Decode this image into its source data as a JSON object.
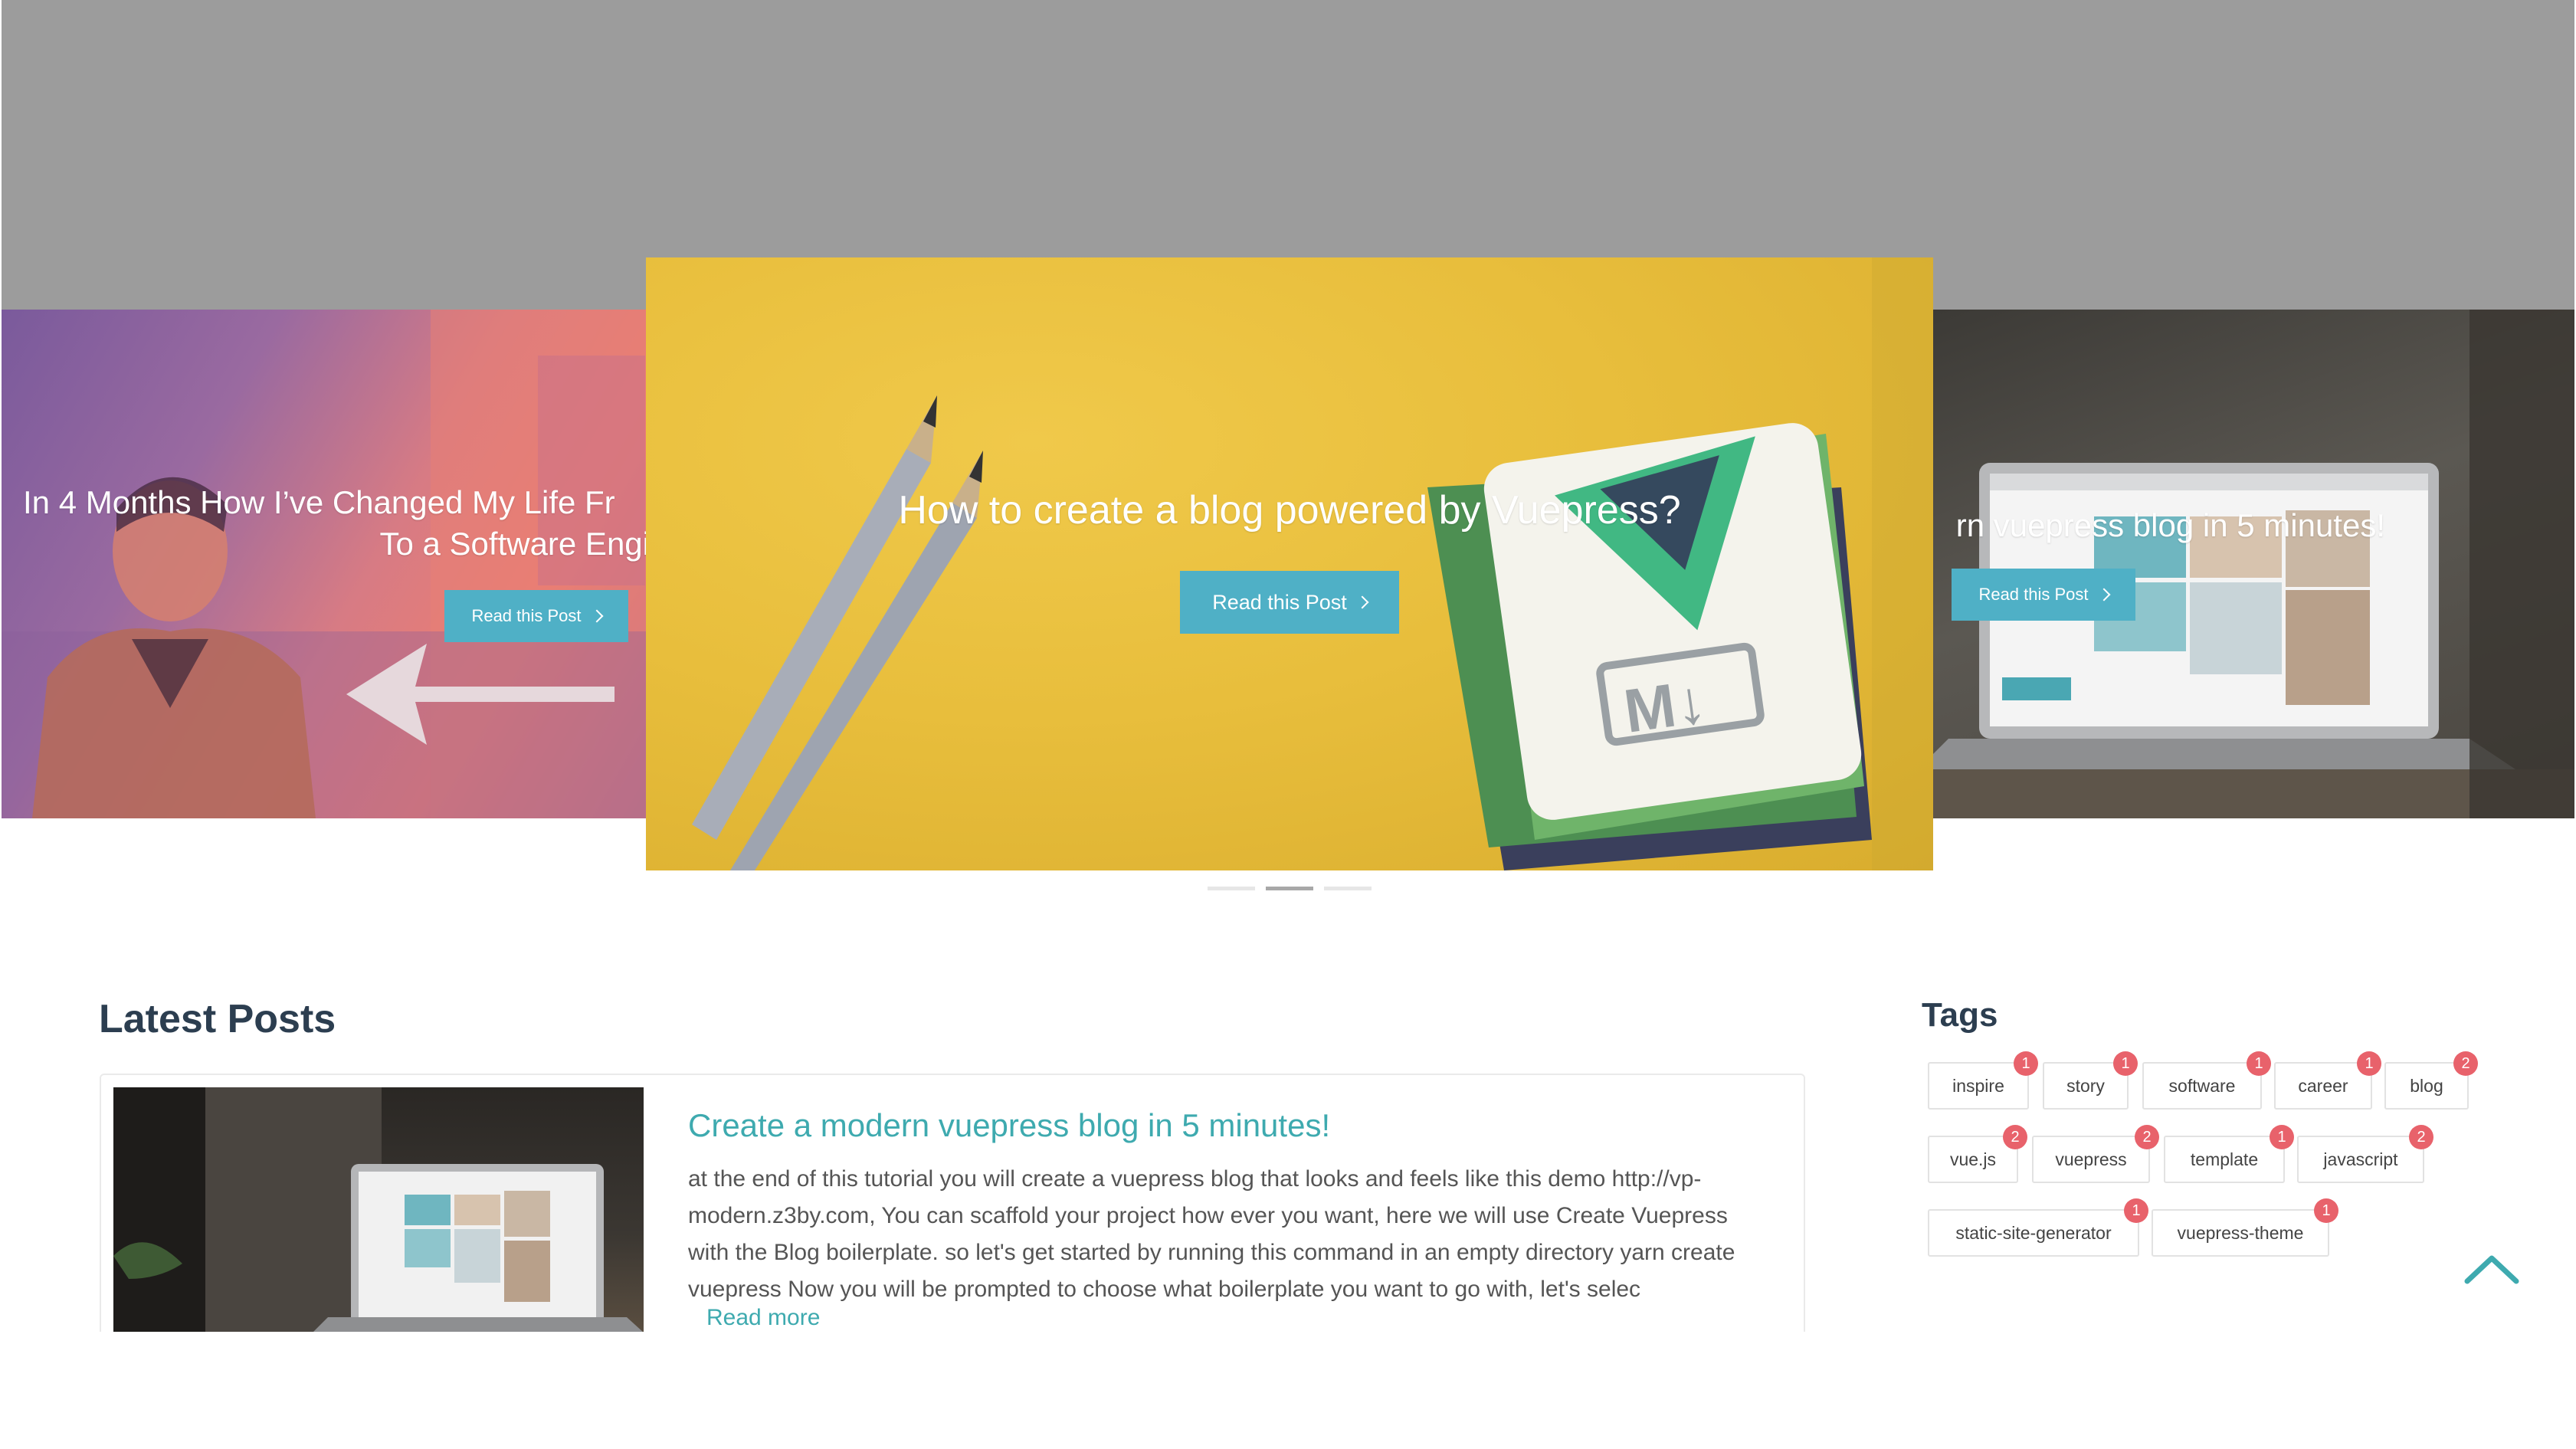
{
  "carousel": {
    "slides": [
      {
        "title_line1": "In 4 Months How I’ve Changed My Life Fr",
        "title_line2": "To a Software Engi",
        "button_label": "Read this Post"
      },
      {
        "title": "How to create a blog powered by Vuepress?",
        "button_label": "Read this Post"
      },
      {
        "title": "rn vuepress blog in 5 minutes!",
        "button_label": "Read this Post"
      }
    ],
    "active_index": 1
  },
  "latest_posts": {
    "heading": "Latest Posts",
    "posts": [
      {
        "title": "Create a modern vuepress blog in 5 minutes!",
        "excerpt": "at the end of this tutorial you will create a vuepress blog that looks and feels like this demo http://vp-modern.z3by.com, You can scaffold your project how ever you want, here we will use Create Vuepress with the Blog boilerplate. so let's get started by running this command in an empty directory yarn create vuepress Now you will be prompted to choose what boilerplate you want to go with, let's selec",
        "read_more": "Read more"
      }
    ]
  },
  "tags": {
    "heading": "Tags",
    "items": [
      {
        "label": "inspire",
        "count": "1"
      },
      {
        "label": "story",
        "count": "1"
      },
      {
        "label": "software",
        "count": "1"
      },
      {
        "label": "career",
        "count": "1"
      },
      {
        "label": "blog",
        "count": "2"
      },
      {
        "label": "vue.js",
        "count": "2"
      },
      {
        "label": "vuepress",
        "count": "2"
      },
      {
        "label": "template",
        "count": "1"
      },
      {
        "label": "javascript",
        "count": "2"
      },
      {
        "label": "static-site-generator",
        "count": "1"
      },
      {
        "label": "vuepress-theme",
        "count": "1"
      }
    ]
  },
  "colors": {
    "accent": "#3eaaaf",
    "button": "#4fb0c6",
    "badge": "#e8626b",
    "heading": "#2c3e50"
  },
  "icons": {
    "back_to_top": "chevron-up-icon",
    "button_chevron": "chevron-right-icon"
  }
}
